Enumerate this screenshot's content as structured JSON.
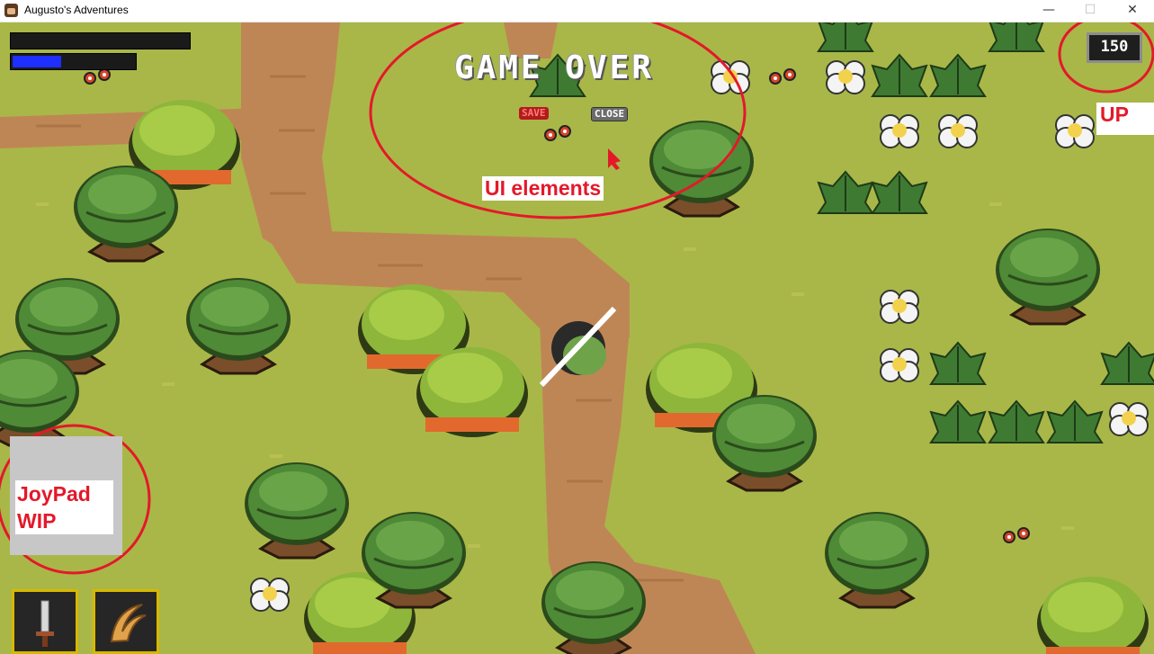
{
  "window": {
    "title": "Augusto's Adventures",
    "minimize_glyph": "—",
    "maximize_glyph": "☐",
    "close_glyph": "✕"
  },
  "hud": {
    "health_fraction": 0.0,
    "stamina_fraction": 0.4,
    "stamina_color": "#1f2fff",
    "score": "150"
  },
  "menu": {
    "heading": "GAME OVER",
    "save_label": "SAVE",
    "close_label": "CLOSE"
  },
  "annotations": {
    "ui_elements": "UI elements",
    "up": "UP",
    "joypad_line1": "JoyPad",
    "joypad_line2": "WIP",
    "circle_color": "#e3192a"
  },
  "inventory": {
    "slots": [
      {
        "icon": "sword-icon"
      },
      {
        "icon": "claw-icon"
      }
    ]
  }
}
